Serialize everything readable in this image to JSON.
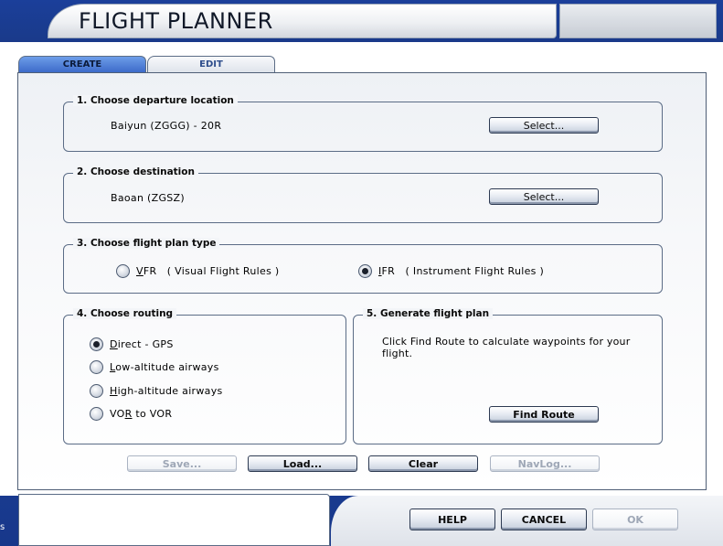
{
  "window": {
    "title": "FLIGHT PLANNER",
    "edge_text": "s"
  },
  "tabs": [
    {
      "label": "CREATE",
      "active": true
    },
    {
      "label": "EDIT",
      "active": false
    }
  ],
  "departure": {
    "heading": "1. Choose departure location",
    "value": "Baiyun (ZGGG) - 20R",
    "select_label": "Select..."
  },
  "destination": {
    "heading": "2. Choose destination",
    "value": "Baoan (ZGSZ)",
    "select_label": "Select..."
  },
  "plan_type": {
    "heading": "3. Choose flight plan type",
    "options": [
      {
        "key": "V",
        "rest": "FR",
        "desc": "( Visual Flight Rules )",
        "checked": false
      },
      {
        "key": "I",
        "rest": "FR",
        "desc": "( Instrument Flight Rules )",
        "checked": true
      }
    ]
  },
  "routing": {
    "heading": "4. Choose routing",
    "options": [
      {
        "key": "D",
        "rest": "irect - GPS",
        "checked": true
      },
      {
        "key": "L",
        "rest": "ow-altitude airways",
        "checked": false
      },
      {
        "key": "H",
        "rest": "igh-altitude airways",
        "checked": false
      },
      {
        "key": "",
        "pre": "VO",
        "keymid": "R",
        "rest": " to VOR",
        "checked": false
      }
    ]
  },
  "generate": {
    "heading": "5. Generate flight plan",
    "note": "Click Find Route to calculate waypoints for your flight.",
    "find_route_label": "Find Route"
  },
  "actions": {
    "save": "Save...",
    "load": "Load...",
    "clear": "Clear",
    "navlog": "NavLog..."
  },
  "footer": {
    "help": "HELP",
    "cancel": "CANCEL",
    "ok": "OK"
  },
  "colors": {
    "frame": "#1a3c8c",
    "tab_active": "#3a67c8",
    "border": "#5b6c86"
  }
}
